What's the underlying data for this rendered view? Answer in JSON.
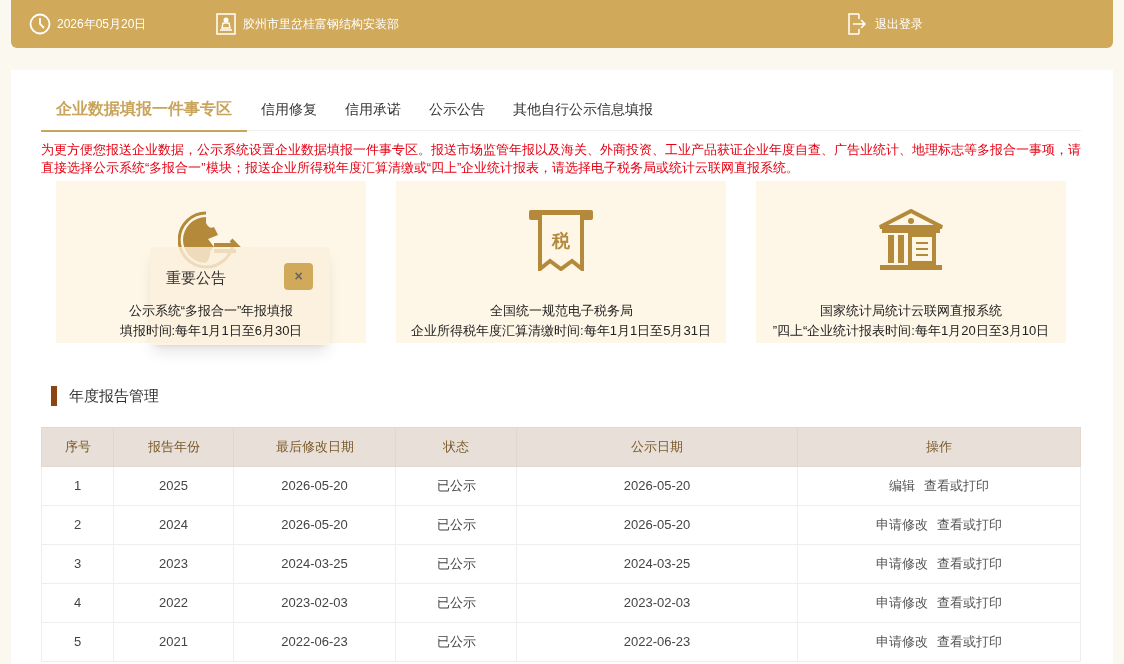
{
  "header": {
    "date": "2026年05月20日",
    "company": "胶州市里岔桂富钢结构安装部",
    "logout": "退出登录"
  },
  "tabs": [
    {
      "label": "企业数据填报一件事专区",
      "selected": true
    },
    {
      "label": "信用修复",
      "selected": false
    },
    {
      "label": "信用承诺",
      "selected": false
    },
    {
      "label": "公示公告",
      "selected": false
    },
    {
      "label": "其他自行公示信息填报",
      "selected": false
    }
  ],
  "notice": "为更方便您报送企业数据，公示系统设置企业数据填报一件事专区。报送市场监管年报以及海关、外商投资、工业产品获证企业年度自查、广告业统计、地理标志等多报合一事项，请直接选择公示系统“多报合一”模块；报送企业所得税年度汇算清缴或“四上”企业统计报表，请选择电子税务局或统计云联网直报系统。",
  "cards": [
    {
      "kind": "globe",
      "title": "公示系统“多报合一”年报填报",
      "time": "填报时间:每年1月1日至6月30日"
    },
    {
      "kind": "tax",
      "icon_text": "税",
      "title": "全国统一规范电子税务局",
      "time": "企业所得税年度汇算清缴时间:每年1月1日至5月31日"
    },
    {
      "kind": "bank",
      "title": "国家统计局统计云联网直报系统",
      "time": "”四上“企业统计报表时间:每年1月20日至3月10日"
    }
  ],
  "popup": {
    "title": "重要公告",
    "close": "×"
  },
  "section_title": "年度报告管理",
  "table": {
    "columns": [
      "序号",
      "报告年份",
      "最后修改日期",
      "状态",
      "公示日期",
      "操作"
    ],
    "rows": [
      {
        "cells": [
          "1",
          "2025",
          "2026-05-20",
          "已公示",
          "2026-05-20"
        ],
        "actions": [
          "编辑",
          "查看或打印"
        ]
      },
      {
        "cells": [
          "2",
          "2024",
          "2026-05-20",
          "已公示",
          "2026-05-20"
        ],
        "actions": [
          "申请修改",
          "查看或打印"
        ]
      },
      {
        "cells": [
          "3",
          "2023",
          "2024-03-25",
          "已公示",
          "2024-03-25"
        ],
        "actions": [
          "申请修改",
          "查看或打印"
        ]
      },
      {
        "cells": [
          "4",
          "2022",
          "2023-02-03",
          "已公示",
          "2023-02-03"
        ],
        "actions": [
          "申请修改",
          "查看或打印"
        ]
      },
      {
        "cells": [
          "5",
          "2021",
          "2022-06-23",
          "已公示",
          "2022-06-23"
        ],
        "actions": [
          "申请修改",
          "查看或打印"
        ]
      }
    ]
  }
}
